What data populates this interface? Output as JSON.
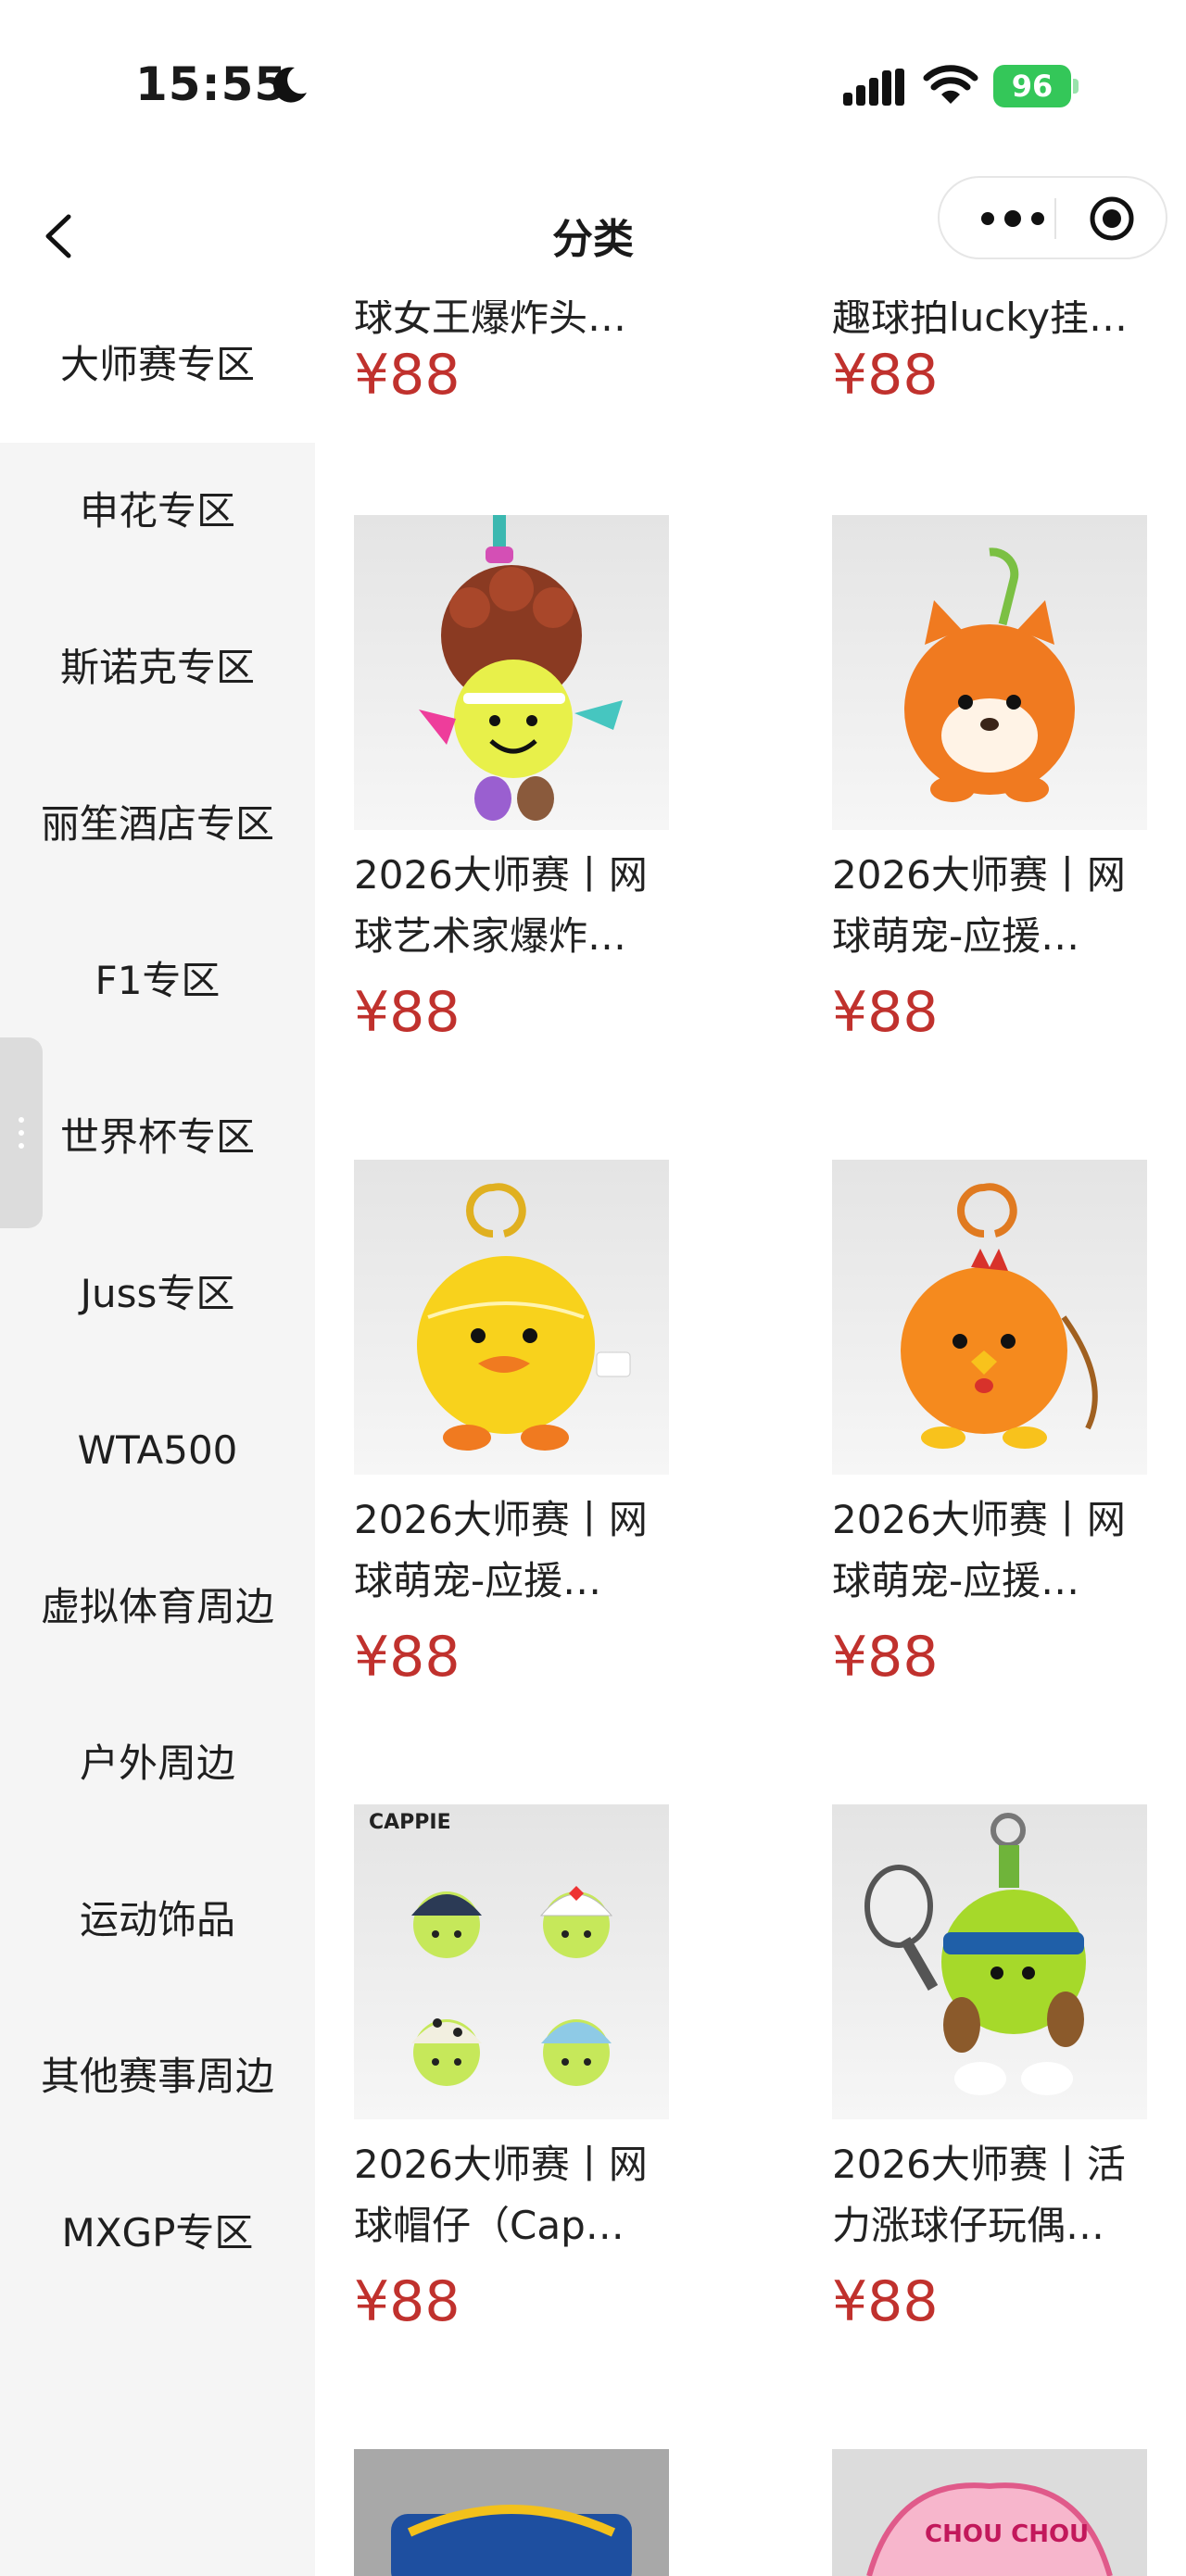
{
  "status_bar": {
    "time": "15:55",
    "battery": "96"
  },
  "nav": {
    "title": "分类"
  },
  "sidebar": {
    "items": [
      {
        "label": "大师赛专区"
      },
      {
        "label": "申花专区"
      },
      {
        "label": "斯诺克专区"
      },
      {
        "label": "丽笙酒店专区"
      },
      {
        "label": "F1专区"
      },
      {
        "label": "世界杯专区"
      },
      {
        "label": "Juss专区"
      },
      {
        "label": "WTA500"
      },
      {
        "label": "虚拟体育周边"
      },
      {
        "label": "户外周边"
      },
      {
        "label": "运动饰品"
      },
      {
        "label": "其他赛事周边"
      },
      {
        "label": "MXGP专区"
      }
    ],
    "active": "大师赛专区"
  },
  "products": {
    "partial": [
      {
        "name_tail": "球女王爆炸头…",
        "price": "¥88"
      },
      {
        "name_tail": "趣球拍lucky挂…",
        "price": "¥88"
      }
    ],
    "items": [
      {
        "name_line1": "2026大师赛丨网",
        "name_line2": "球艺术家爆炸…",
        "price": "¥88",
        "image": "tennis-ball-artist-plush"
      },
      {
        "name_line1": "2026大师赛丨网",
        "name_line2": "球萌宠-应援…",
        "price": "¥88",
        "image": "shiba-tennis-ball-plush"
      },
      {
        "name_line1": "2026大师赛丨网",
        "name_line2": "球萌宠-应援…",
        "price": "¥88",
        "image": "duck-tennis-ball-plush"
      },
      {
        "name_line1": "2026大师赛丨网",
        "name_line2": "球萌宠-应援…",
        "price": "¥88",
        "image": "rooster-tennis-ball-plush"
      },
      {
        "name_line1": "2026大师赛丨网",
        "name_line2": "球帽仔（Cap…",
        "price": "¥88",
        "image": "cappie-keychains",
        "image_text": "CAPPIE"
      },
      {
        "name_line1": "2026大师赛丨活",
        "name_line2": "力涨球仔玩偶…",
        "price": "¥88",
        "image": "tennis-racket-ball-plush"
      }
    ],
    "bottom_partial": [
      {
        "image": "keychain-product"
      },
      {
        "image": "chou-chou-keychain",
        "image_text": "CHOU CHOU"
      }
    ]
  },
  "colors": {
    "price": "#c0312d",
    "sidebar_bg": "#f5f5f5",
    "battery": "#34c759"
  }
}
